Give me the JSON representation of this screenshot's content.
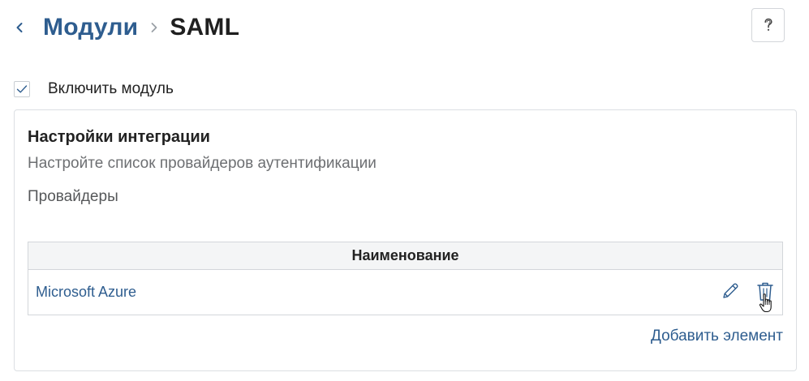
{
  "header": {
    "back_icon": "chevron-left-icon",
    "breadcrumb_parent": "Модули",
    "separator_icon": "chevron-right-icon",
    "breadcrumb_current": "SAML",
    "help_icon": "question-mark-icon"
  },
  "enable_module": {
    "checked": true,
    "label": "Включить модуль"
  },
  "integration": {
    "title": "Настройки интеграции",
    "description": "Настройте список провайдеров аутентификации",
    "providers_label": "Провайдеры",
    "table": {
      "columns": [
        "Наименование"
      ],
      "rows": [
        {
          "name": "Microsoft Azure",
          "actions": [
            "pencil-icon",
            "trash-icon"
          ]
        }
      ]
    },
    "add_label": "Добавить элемент"
  },
  "colors": {
    "link": "#2e5d8f",
    "text": "#222222",
    "muted": "#6d6f72",
    "border": "#d3d6da",
    "table_header_bg": "#f4f5f6"
  }
}
